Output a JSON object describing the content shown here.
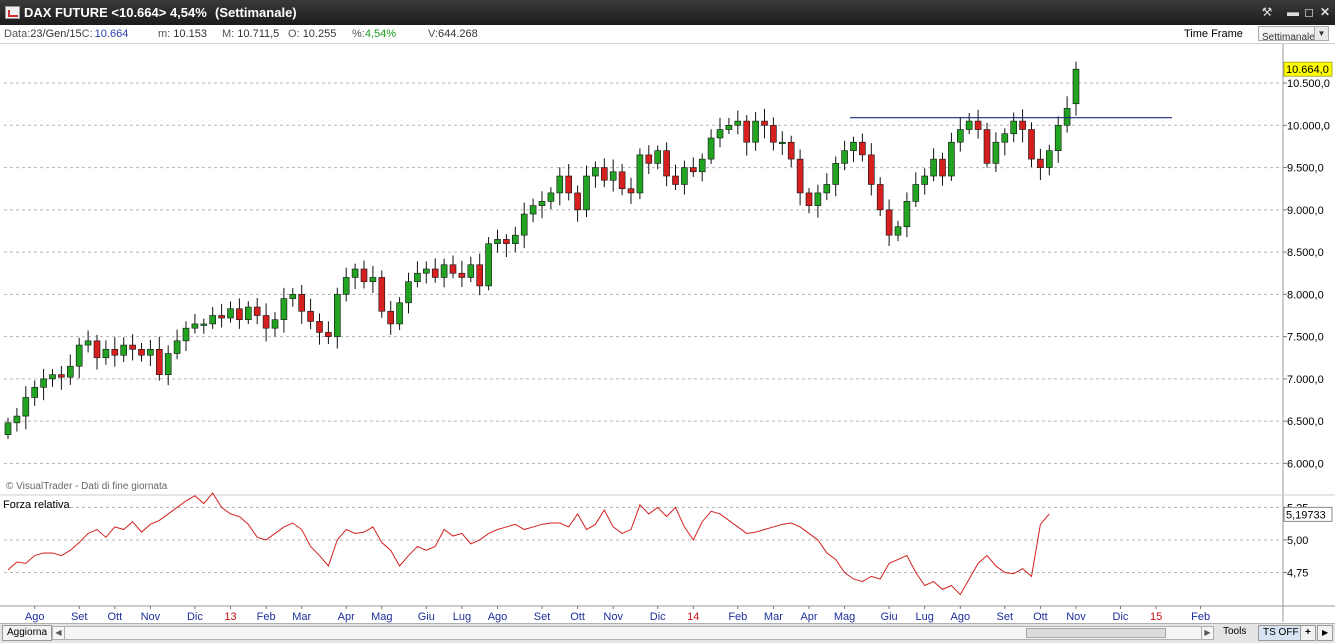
{
  "window": {
    "title": "DAX FUTURE <10.664> 4,54%",
    "period": "(Settimanale)",
    "buttons": [
      "tools-icon",
      "minimize-icon",
      "maximize-icon",
      "close-icon"
    ]
  },
  "info_bar": {
    "date_label": "Data:",
    "date_value": "23/Gen/15",
    "close_label": "C:",
    "close_value": "10.664",
    "min_label": "m:",
    "min_value": "10.153",
    "max_label": "M:",
    "max_value": "10.711,5",
    "open_label": "O:",
    "open_value": "10.255",
    "pct_label": "%:",
    "pct_value": "4,54%",
    "vol_label": "V:",
    "vol_value": "644.268",
    "timeframe_label": "Time Frame",
    "timeframe_value": "Settimanale"
  },
  "chart_data": [
    {
      "type": "candlestick",
      "title": "DAX FUTURE",
      "watermark": "© VisualTrader - Dati di fine giornata",
      "ylim": [
        5650,
        10950
      ],
      "y_ticks": [
        {
          "v": 6000,
          "label": "6.000,0"
        },
        {
          "v": 6500,
          "label": "6.500,0"
        },
        {
          "v": 7000,
          "label": "7.000,0"
        },
        {
          "v": 7500,
          "label": "7.500,0"
        },
        {
          "v": 8000,
          "label": "8.000,0"
        },
        {
          "v": 8500,
          "label": "8.500,0"
        },
        {
          "v": 9000,
          "label": "9.000,0"
        },
        {
          "v": 9500,
          "label": "9.500,0"
        },
        {
          "v": 10000,
          "label": "10.000,0"
        },
        {
          "v": 10500,
          "label": "10.500,0"
        }
      ],
      "last_value_label": "10.664,0",
      "last_value": 10664,
      "resistance_level": 10090,
      "up_color": "#22a322",
      "down_color": "#d62020",
      "x_labels": [
        {
          "i": 3,
          "label": "Ago",
          "color": "#1c2f9c"
        },
        {
          "i": 8,
          "label": "Set",
          "color": "#1c2f9c"
        },
        {
          "i": 12,
          "label": "Ott",
          "color": "#1c2f9c"
        },
        {
          "i": 16,
          "label": "Nov",
          "color": "#1c2f9c"
        },
        {
          "i": 21,
          "label": "Dic",
          "color": "#1c2f9c"
        },
        {
          "i": 25,
          "label": "13",
          "color": "#cc1111"
        },
        {
          "i": 29,
          "label": "Feb",
          "color": "#1c2f9c"
        },
        {
          "i": 33,
          "label": "Mar",
          "color": "#1c2f9c"
        },
        {
          "i": 38,
          "label": "Apr",
          "color": "#1c2f9c"
        },
        {
          "i": 42,
          "label": "Mag",
          "color": "#1c2f9c"
        },
        {
          "i": 47,
          "label": "Giu",
          "color": "#1c2f9c"
        },
        {
          "i": 51,
          "label": "Lug",
          "color": "#1c2f9c"
        },
        {
          "i": 55,
          "label": "Ago",
          "color": "#1c2f9c"
        },
        {
          "i": 60,
          "label": "Set",
          "color": "#1c2f9c"
        },
        {
          "i": 64,
          "label": "Ott",
          "color": "#1c2f9c"
        },
        {
          "i": 68,
          "label": "Nov",
          "color": "#1c2f9c"
        },
        {
          "i": 73,
          "label": "Dic",
          "color": "#1c2f9c"
        },
        {
          "i": 77,
          "label": "14",
          "color": "#cc1111"
        },
        {
          "i": 82,
          "label": "Feb",
          "color": "#1c2f9c"
        },
        {
          "i": 86,
          "label": "Mar",
          "color": "#1c2f9c"
        },
        {
          "i": 90,
          "label": "Apr",
          "color": "#1c2f9c"
        },
        {
          "i": 94,
          "label": "Mag",
          "color": "#1c2f9c"
        },
        {
          "i": 99,
          "label": "Giu",
          "color": "#1c2f9c"
        },
        {
          "i": 103,
          "label": "Lug",
          "color": "#1c2f9c"
        },
        {
          "i": 107,
          "label": "Ago",
          "color": "#1c2f9c"
        },
        {
          "i": 112,
          "label": "Set",
          "color": "#1c2f9c"
        },
        {
          "i": 116,
          "label": "Ott",
          "color": "#1c2f9c"
        },
        {
          "i": 120,
          "label": "Nov",
          "color": "#1c2f9c"
        },
        {
          "i": 125,
          "label": "Dic",
          "color": "#1c2f9c"
        },
        {
          "i": 129,
          "label": "15",
          "color": "#cc1111"
        },
        {
          "i": 134,
          "label": "Feb",
          "color": "#1c2f9c"
        }
      ],
      "closes": [
        6480,
        6560,
        6780,
        6900,
        7000,
        7050,
        7020,
        7150,
        7400,
        7450,
        7250,
        7350,
        7280,
        7400,
        7350,
        7280,
        7350,
        7050,
        7300,
        7450,
        7600,
        7650,
        7650,
        7750,
        7720,
        7830,
        7700,
        7850,
        7750,
        7600,
        7700,
        7950,
        8000,
        7800,
        7680,
        7550,
        7500,
        8000,
        8200,
        8300,
        8150,
        8200,
        7800,
        7650,
        7900,
        8150,
        8250,
        8300,
        8200,
        8350,
        8250,
        8200,
        8350,
        8100,
        8600,
        8650,
        8600,
        8700,
        8950,
        9050,
        9100,
        9200,
        9400,
        9200,
        9000,
        9400,
        9500,
        9350,
        9450,
        9250,
        9200,
        9650,
        9550,
        9700,
        9400,
        9300,
        9500,
        9450,
        9600,
        9850,
        9950,
        10000,
        10050,
        9800,
        10050,
        10000,
        9800,
        9800,
        9600,
        9200,
        9050,
        9200,
        9300,
        9550,
        9700,
        9800,
        9650,
        9300,
        9000,
        8700,
        8800,
        9100,
        9300,
        9400,
        9600,
        9400,
        9800,
        9950,
        10050,
        9950,
        9550,
        9800,
        9900,
        10050,
        9950,
        9600,
        9500,
        9700,
        10000,
        10200,
        10664
      ],
      "opens": [
        6340,
        6480,
        6560,
        6780,
        6900,
        7000,
        7050,
        7020,
        7150,
        7400,
        7450,
        7250,
        7350,
        7280,
        7400,
        7350,
        7280,
        7350,
        7050,
        7300,
        7450,
        7600,
        7650,
        7650,
        7750,
        7720,
        7830,
        7700,
        7850,
        7750,
        7600,
        7700,
        7950,
        8000,
        7800,
        7680,
        7550,
        7500,
        8000,
        8200,
        8300,
        8150,
        8200,
        7800,
        7650,
        7900,
        8150,
        8250,
        8300,
        8200,
        8350,
        8250,
        8200,
        8350,
        8100,
        8600,
        8650,
        8600,
        8700,
        8950,
        9050,
        9100,
        9200,
        9400,
        9200,
        9000,
        9400,
        9500,
        9350,
        9450,
        9250,
        9200,
        9650,
        9550,
        9700,
        9400,
        9300,
        9500,
        9450,
        9600,
        9850,
        9950,
        10000,
        10050,
        9800,
        10050,
        10000,
        9800,
        9800,
        9600,
        9200,
        9050,
        9200,
        9300,
        9550,
        9700,
        9800,
        9650,
        9300,
        9000,
        8700,
        8800,
        9100,
        9300,
        9400,
        9600,
        9400,
        9800,
        9950,
        10050,
        9950,
        9550,
        9800,
        9900,
        10050,
        9950,
        9600,
        9500,
        9700,
        10000,
        10255
      ]
    },
    {
      "type": "line",
      "title": "Forza relativa",
      "ylim": [
        4.5,
        5.33
      ],
      "y_ticks": [
        {
          "v": 4.75,
          "label": "4,75"
        },
        {
          "v": 5.0,
          "label": "5,00"
        },
        {
          "v": 5.25,
          "label": "5,25"
        }
      ],
      "last_value_label": "5,19733",
      "last_value": 5.19733,
      "line_color": "#d42020",
      "values": [
        4.77,
        4.83,
        4.82,
        4.88,
        4.9,
        4.9,
        4.88,
        4.92,
        4.98,
        5.05,
        5.08,
        5.02,
        5.1,
        5.08,
        5.14,
        5.06,
        5.12,
        5.15,
        5.2,
        5.25,
        5.3,
        5.34,
        5.28,
        5.36,
        5.25,
        5.2,
        5.18,
        5.12,
        5.02,
        5.0,
        5.05,
        5.1,
        5.13,
        5.08,
        4.95,
        4.88,
        4.8,
        5.0,
        5.08,
        5.05,
        5.06,
        5.1,
        4.98,
        4.92,
        4.8,
        4.88,
        4.95,
        4.92,
        4.95,
        5.08,
        5.03,
        5.05,
        4.97,
        5.0,
        5.05,
        5.08,
        5.1,
        5.12,
        5.08,
        5.1,
        5.12,
        5.13,
        5.13,
        5.1,
        5.2,
        5.08,
        5.12,
        5.23,
        5.1,
        5.05,
        5.08,
        5.27,
        5.2,
        5.25,
        5.18,
        5.25,
        5.1,
        5.0,
        5.14,
        5.22,
        5.2,
        5.15,
        5.1,
        5.05,
        5.06,
        5.08,
        5.1,
        5.12,
        5.13,
        5.1,
        5.05,
        5.0,
        4.9,
        4.85,
        4.75,
        4.7,
        4.68,
        4.72,
        4.7,
        4.82,
        4.85,
        4.88,
        4.75,
        4.65,
        4.68,
        4.62,
        4.65,
        4.58,
        4.7,
        4.82,
        4.88,
        4.8,
        4.75,
        4.74,
        4.78,
        4.72,
        5.12,
        5.2
      ]
    }
  ],
  "bottom_bar": {
    "refresh_label": "Aggiorna",
    "tools_label": "Tools",
    "ts_label": "TS OFF",
    "plus_label": "+"
  }
}
